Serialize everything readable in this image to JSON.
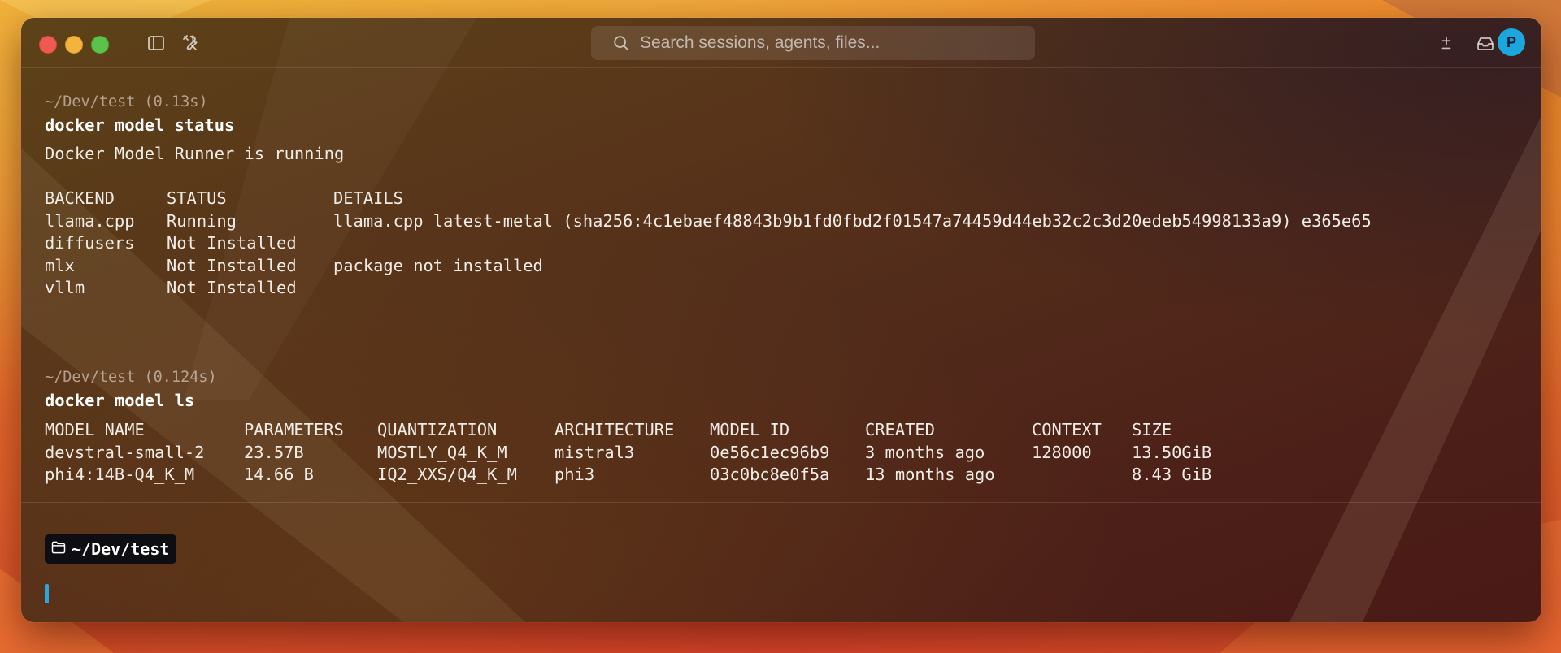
{
  "search": {
    "placeholder": "Search sessions, agents, files..."
  },
  "user": {
    "avatar_initial": "P"
  },
  "blocks": [
    {
      "meta": "~/Dev/test (0.13s)",
      "command": "docker model status",
      "output_line": "Docker Model Runner is running",
      "table": {
        "headers": [
          "BACKEND",
          "STATUS",
          "DETAILS"
        ],
        "rows": [
          [
            "llama.cpp",
            "Running",
            "llama.cpp latest-metal (sha256:4c1ebaef48843b9b1fd0fbd2f01547a74459d44eb32c2c3d20edeb54998133a9) e365e65"
          ],
          [
            "diffusers",
            "Not Installed",
            ""
          ],
          [
            "mlx",
            "Not Installed",
            "package not installed"
          ],
          [
            "vllm",
            "Not Installed",
            ""
          ]
        ]
      }
    },
    {
      "meta": "~/Dev/test (0.124s)",
      "command": "docker model ls",
      "table": {
        "headers": [
          "MODEL NAME",
          "PARAMETERS",
          "QUANTIZATION",
          "ARCHITECTURE",
          "MODEL ID",
          "CREATED",
          "CONTEXT",
          "SIZE"
        ],
        "rows": [
          [
            "devstral-small-2",
            "23.57B",
            "MOSTLY_Q4_K_M",
            "mistral3",
            "0e56c1ec96b9",
            "3 months ago",
            "128000",
            "13.50GiB"
          ],
          [
            "phi4:14B-Q4_K_M",
            "14.66 B",
            "IQ2_XXS/Q4_K_M",
            "phi3",
            "03c0bc8e0f5a",
            "13 months ago",
            "",
            "8.43 GiB"
          ]
        ]
      }
    }
  ],
  "prompt": {
    "cwd": "~/Dev/test"
  },
  "icons": {
    "sidebar": "sidebar-toggle-icon",
    "tools": "tools-icon",
    "search": "search-icon",
    "add": "plus-minus-icon",
    "inbox": "inbox-icon",
    "folder": "folder-icon"
  },
  "colors": {
    "accent": "#2aa7e0",
    "avatar_bg": "#1ba7de",
    "close": "#ee5a52",
    "minimize": "#f4b33c",
    "zoom": "#5cc24a"
  }
}
